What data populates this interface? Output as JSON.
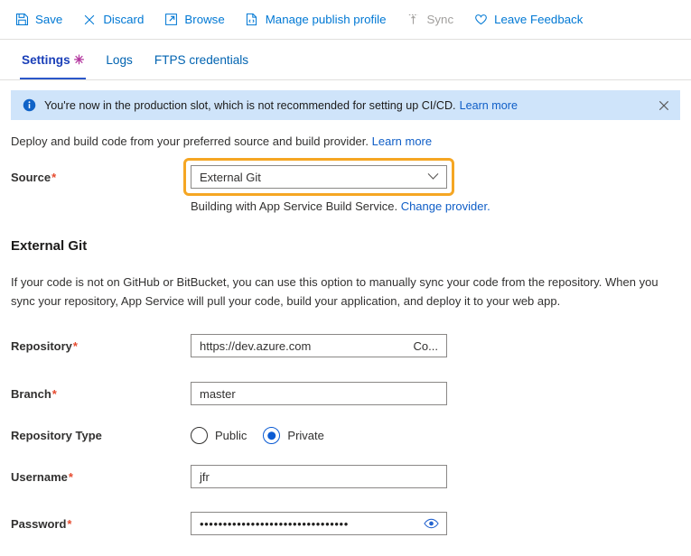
{
  "commandbar": {
    "items": [
      {
        "label": "Save",
        "icon": "save-icon",
        "disabled": false
      },
      {
        "label": "Discard",
        "icon": "close-x-icon",
        "disabled": false
      },
      {
        "label": "Browse",
        "icon": "open-external-icon",
        "disabled": false
      },
      {
        "label": "Manage publish profile",
        "icon": "code-file-icon",
        "disabled": false
      },
      {
        "label": "Sync",
        "icon": "sync-icon",
        "disabled": true
      },
      {
        "label": "Leave Feedback",
        "icon": "heart-icon",
        "disabled": false
      }
    ]
  },
  "tabs": [
    {
      "label": "Settings",
      "active": true,
      "dirty_marker": "✳"
    },
    {
      "label": "Logs",
      "active": false,
      "dirty_marker": ""
    },
    {
      "label": "FTPS credentials",
      "active": false,
      "dirty_marker": ""
    }
  ],
  "banner": {
    "icon": "info-icon",
    "text": "You're now in the production slot, which is not recommended for setting up CI/CD.",
    "link": "Learn more",
    "close_icon": "close-icon",
    "background": "#cfe4fa"
  },
  "intro": {
    "text": "Deploy and build code from your preferred source and build provider.",
    "link": "Learn more"
  },
  "source": {
    "label": "Source",
    "required_marker": "*",
    "value": "External Git",
    "chevron_icon": "chevron-down-icon",
    "highlight_color": "#f5a623"
  },
  "build_note": {
    "text": "Building with App Service Build Service.",
    "link": "Change provider."
  },
  "section": {
    "title": "External Git",
    "description": "If your code is not on GitHub or BitBucket, you can use this option to manually sync your code from the repository. When you sync your repository, App Service will pull your code, build your application, and deploy it to your web app."
  },
  "form": {
    "repository": {
      "label": "Repository",
      "required_marker": "*",
      "value": "https://dev.azure.com",
      "overflow_text": "Co..."
    },
    "branch": {
      "label": "Branch",
      "required_marker": "*",
      "value": "master"
    },
    "repository_type": {
      "label": "Repository Type",
      "options": [
        {
          "label": "Public",
          "selected": false
        },
        {
          "label": "Private",
          "selected": true
        }
      ]
    },
    "username": {
      "label": "Username",
      "required_marker": "*",
      "value": "jfr"
    },
    "password": {
      "label": "Password",
      "required_marker": "*",
      "value": "••••••••••••••••••••••••••••••••",
      "reveal_icon": "eye-icon"
    }
  }
}
